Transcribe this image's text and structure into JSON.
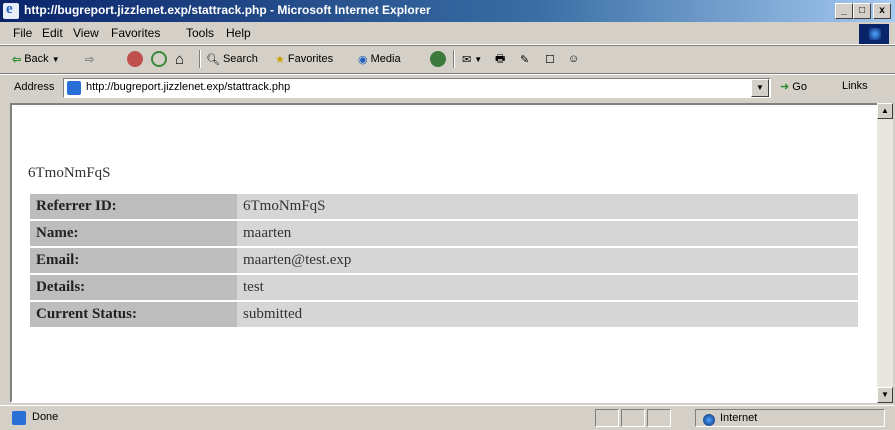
{
  "window": {
    "title": "http://bugreport.jizzlenet.exp/stattrack.php - Microsoft Internet Explorer",
    "min": "_",
    "max": "□",
    "close": "x"
  },
  "menu": [
    "File",
    "Edit",
    "View",
    "Favorites",
    "Tools",
    "Help"
  ],
  "toolbar": {
    "back": "Back",
    "search": "Search",
    "favorites": "Favorites",
    "media": "Media"
  },
  "address": {
    "label": "Address",
    "url": "http://bugreport.jizzlenet.exp/stattrack.php",
    "go": "Go",
    "links": "Links"
  },
  "page": {
    "heading": "6TmoNmFqS",
    "rows": [
      {
        "label": "Referrer ID:",
        "value": "6TmoNmFqS"
      },
      {
        "label": "Name:",
        "value": "maarten"
      },
      {
        "label": "Email:",
        "value": "maarten@test.exp"
      },
      {
        "label": "Details:",
        "value": "test"
      },
      {
        "label": "Current Status:",
        "value": "submitted"
      }
    ]
  },
  "status": {
    "text": "Done",
    "zone": "Internet"
  }
}
